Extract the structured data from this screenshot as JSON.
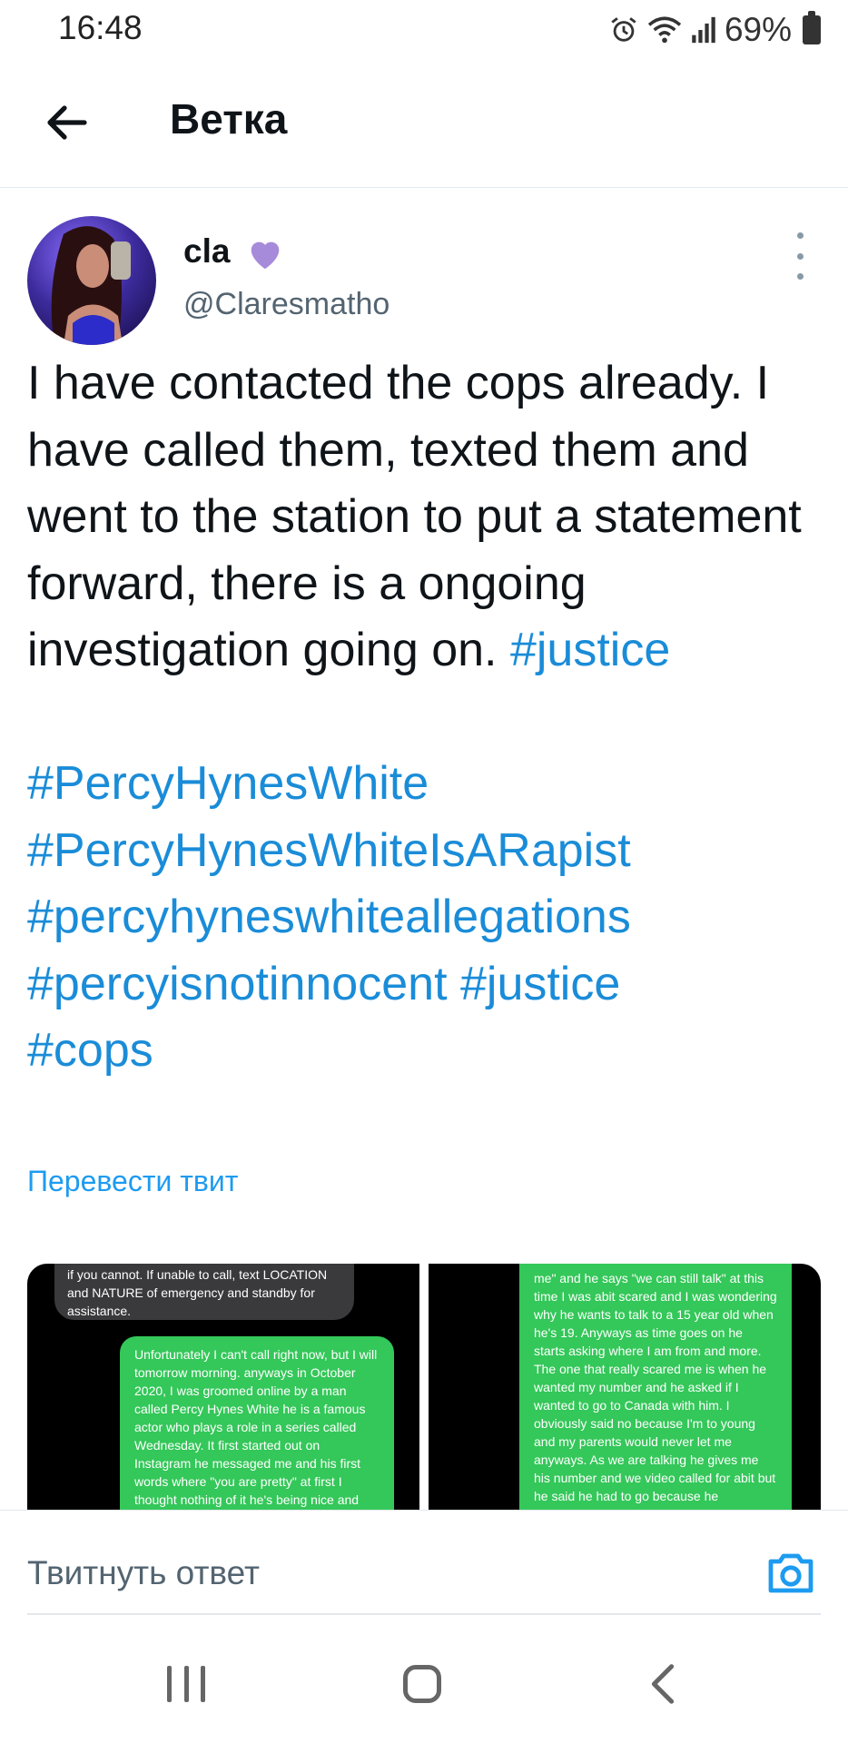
{
  "status_bar": {
    "time": "16:48",
    "battery": "69%",
    "icons": [
      "alarm-icon",
      "wifi-icon",
      "signal-icon",
      "battery-icon"
    ]
  },
  "header": {
    "title": "Ветка",
    "back_icon": "arrow-left-icon"
  },
  "tweet": {
    "author_name": "cla",
    "author_emoji": "purple-heart",
    "author_handle": "@Claresmatho",
    "text_plain": "I have contacted the cops already. I have called them, texted them and went to the station to put a statement forward, there is a ongoing investigation going on. ",
    "hashtag_inline": "#justice",
    "hashtags": [
      "#PercyHynesWhite",
      "#PercyHynesWhiteIsARapist",
      "#percyhyneswhiteallegations",
      "#percyisnotinnocent",
      "#justice",
      "#cops"
    ],
    "translate_label": "Перевести твит",
    "media": [
      {
        "grey_bubble": "if you cannot. If unable to call, text LOCATION and NATURE of emergency and standby for assistance.",
        "green_bubble": "Unfortunately I can't call right now, but I will tomorrow morning. anyways in October 2020, I was groomed online by a man called Percy Hynes White he is a famous actor who plays a role in a series called Wednesday. It first started out on Instagram he messaged me and his first words where \"you are pretty\" at first I thought nothing of it he's being nice and friendly but"
      },
      {
        "green_bubble": "me\" and he says \"we can still talk\" at this time I was abit scared and I was wondering why he wants to talk to a 15 year old when he's 19. Anyways as time goes on he starts asking where I am from and more. The one that really scared me is when he wanted my number and he asked if I wanted to go to Canada with him. I obviously said no because I'm to young and my parents would never let me anyways. As we are talking he gives me his number and we video called for abit but he said he had to go because he"
      }
    ]
  },
  "reply_bar": {
    "placeholder": "Твитнуть ответ",
    "camera_icon": "camera-icon"
  },
  "nav_bar": {
    "icons": [
      "recent-apps-icon",
      "home-icon",
      "back-icon"
    ]
  },
  "colors": {
    "link": "#1d9bf0",
    "text": "#0f1419",
    "secondary": "#536471",
    "heart": "#a78bdb",
    "bubble_green": "#34c759"
  }
}
